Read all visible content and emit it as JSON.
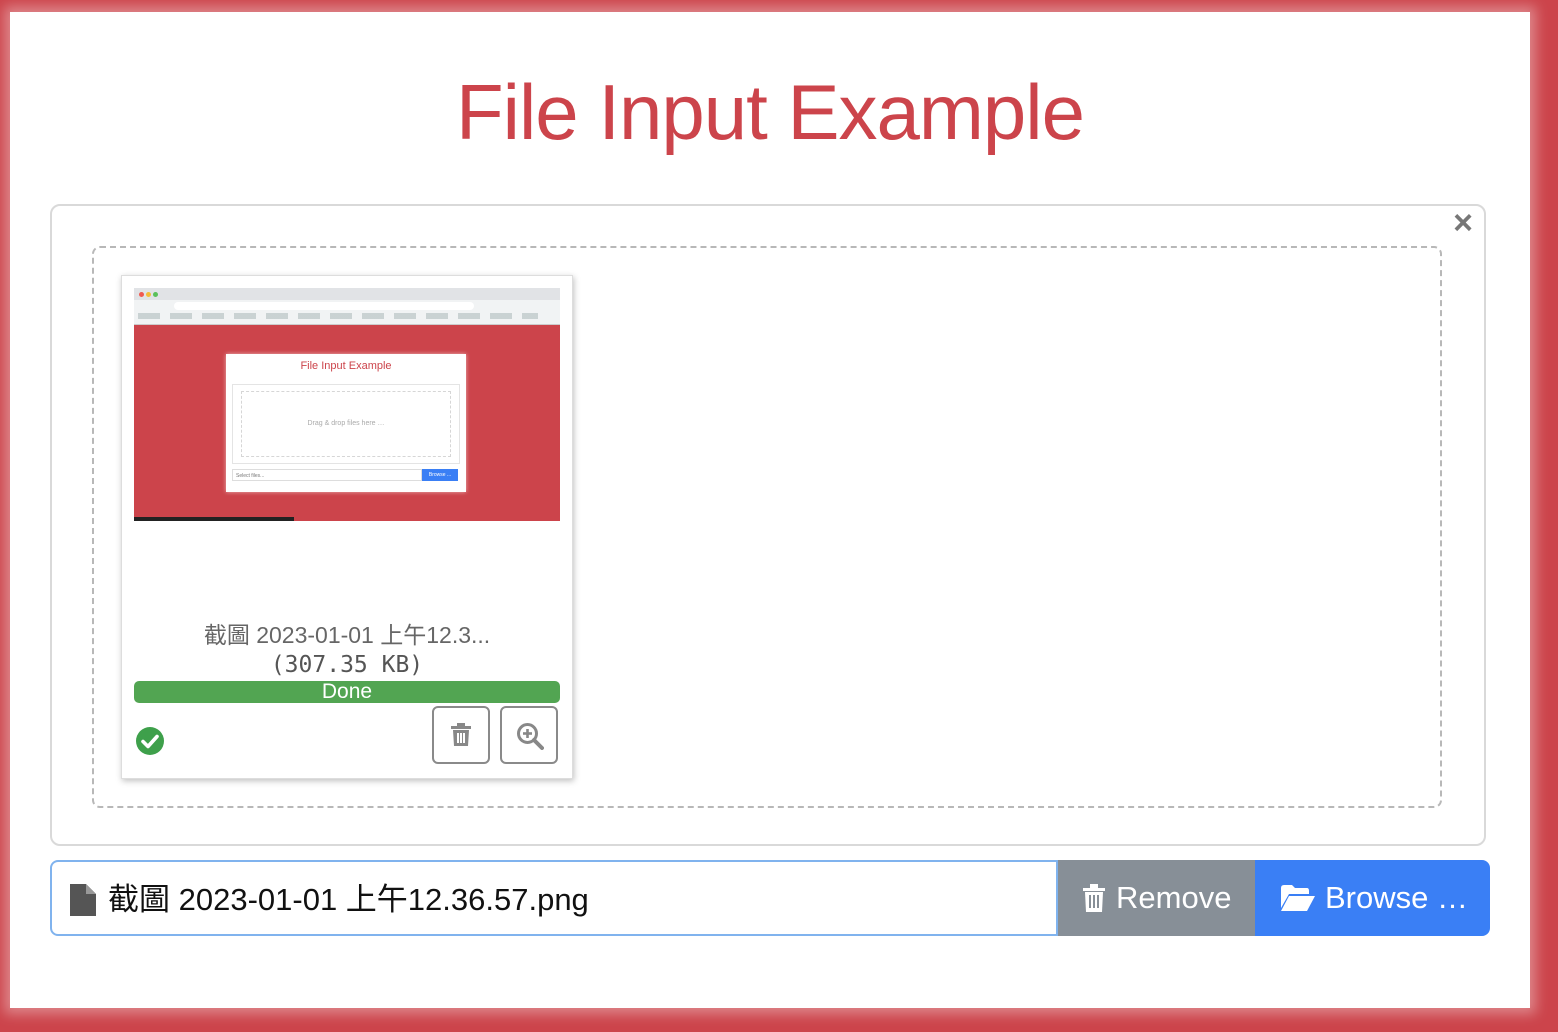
{
  "page": {
    "title": "File Input Example"
  },
  "panel": {
    "close_icon": "×"
  },
  "preview": {
    "title": "File Input Example",
    "drop_hint": "Drag & drop files here …",
    "select_placeholder": "Select files...",
    "browse_label": "Browse ..."
  },
  "thumbnail": {
    "caption": "截圖 2023-01-01 上午12.3...",
    "size": "(307.35 KB)",
    "progress_label": "Done",
    "progress_percent": 100,
    "status_icon": "check-circle-icon",
    "delete_icon": "trash-icon",
    "zoom_icon": "zoom-in-icon"
  },
  "input": {
    "caption": "截圖 2023-01-01 上午12.36.57.png",
    "file_icon": "file-icon",
    "remove_label": "Remove",
    "browse_label": "Browse …"
  },
  "colors": {
    "accent": "#cc444b",
    "primary": "#3a7ff5",
    "secondary": "#878f97",
    "success": "#52a552"
  }
}
